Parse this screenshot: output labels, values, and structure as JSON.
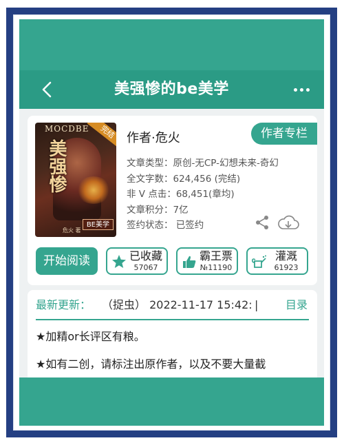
{
  "header": {
    "title": "美强惨的be美学"
  },
  "book": {
    "cover": {
      "top_text": "MOCDBE",
      "title": "美强惨",
      "ribbon": "完结",
      "badge": "BE美学",
      "author_small": "危火 著"
    },
    "author_line": "作者·危火",
    "author_button": "作者专栏",
    "meta": {
      "type": "文章类型：原创-无CP-幻想未来-奇幻",
      "words": "全文字数：624,456 (完结)",
      "clicks": "非 V 点击：68,451(章均)",
      "score": "文章积分：7亿",
      "contract": "签约状态：  已签约"
    },
    "actions": {
      "read": "开始阅读",
      "collect": {
        "label": "已收藏",
        "count": "57067"
      },
      "bawang": {
        "label": "霸王票",
        "count": "№11190"
      },
      "irrigate": {
        "label": "灌溉",
        "count": "61923"
      }
    }
  },
  "update": {
    "label": "最新更新：",
    "text": "（捉虫）  2022-11-17 15:42:(",
    "separator": "|",
    "toc": "目录"
  },
  "notices": [
    "★加精or长评区有粮。",
    "★如有二创，请标注出原作者，以及不要大量截"
  ],
  "colors": {
    "accent": "#35a58f",
    "header": "#2b9b85",
    "frame": "#243f82"
  }
}
